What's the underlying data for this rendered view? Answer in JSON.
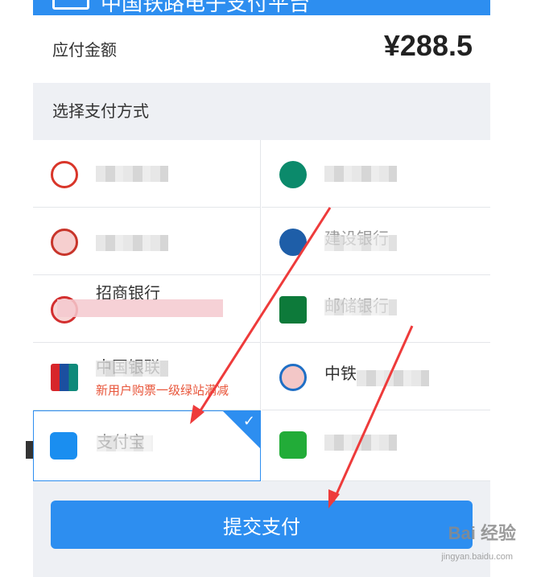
{
  "header": {
    "title": "中国铁路电子支付平台",
    "icon": "card-icon"
  },
  "amount": {
    "label": "应付金额",
    "value": "¥288.5"
  },
  "section_title": "选择支付方式",
  "methods": [
    {
      "name": "",
      "promo": "",
      "icon": "icbc-icon",
      "color": "#d9362a"
    },
    {
      "name": "",
      "promo": "",
      "icon": "abc-icon",
      "color": "#0b8a6b"
    },
    {
      "name": "",
      "promo": "",
      "icon": "boc-icon",
      "color": "#c8352b"
    },
    {
      "name": "建设银行",
      "promo": "",
      "icon": "ccb-icon",
      "color": "#1e5ea8"
    },
    {
      "name": "招商银行",
      "promo": "",
      "icon": "cmb-icon",
      "color": "#d32f2f"
    },
    {
      "name": "邮储银行",
      "promo": "",
      "icon": "psbc-icon",
      "color": "#0d7a3a"
    },
    {
      "name": "中国银联",
      "promo": "新用户购票一级绿站满减",
      "icon": "unionpay-icon",
      "color": "#d7262b"
    },
    {
      "name": "中铁",
      "promo": "",
      "icon": "railway-icon",
      "color": "#1f6fc5"
    },
    {
      "name": "支付宝",
      "promo": "",
      "icon": "alipay-icon",
      "color": "#1a8ef0",
      "selected": true
    },
    {
      "name": "",
      "promo": "",
      "icon": "wechat-pay-icon",
      "color": "#22ac38"
    }
  ],
  "submit": {
    "label": "提交支付"
  },
  "watermark": {
    "brand": "Bai 经验",
    "url": "jingyan.baidu.com"
  },
  "colors": {
    "accent": "#2d8ef0",
    "arrow": "#ee3b3b",
    "promo": "#e8553a"
  }
}
